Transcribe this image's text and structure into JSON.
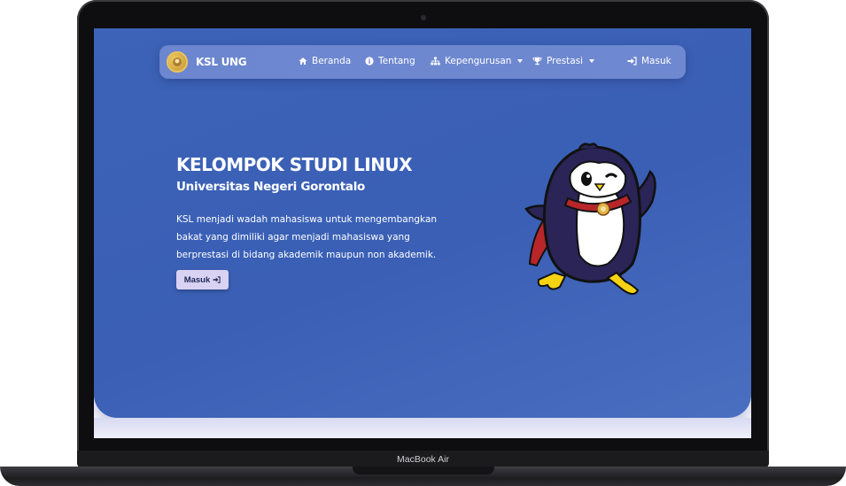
{
  "device": {
    "label": "MacBook Air"
  },
  "navbar": {
    "brand": "KSL UNG",
    "items": [
      {
        "label": "Beranda",
        "icon": "home-icon",
        "dropdown": false
      },
      {
        "label": "Tentang",
        "icon": "info-circle-icon",
        "dropdown": false
      },
      {
        "label": "Kepengurusan",
        "icon": "sitemap-icon",
        "dropdown": true
      },
      {
        "label": "Prestasi",
        "icon": "trophy-icon",
        "dropdown": true
      },
      {
        "label": "Masuk",
        "icon": "sign-in-icon",
        "dropdown": false
      }
    ]
  },
  "hero": {
    "title": "KELOMPOK STUDI LINUX",
    "subtitle": "Universitas Negeri Gorontalo",
    "description": "KSL menjadi wadah mahasiswa untuk mengembangkan bakat yang dimiliki agar menjadi mahasiswa yang berprestasi di bidang akademik maupun non akademik.",
    "cta_label": "Masuk"
  },
  "colors": {
    "hero_bg": "#3c63b8",
    "navbar_bg": "#6c86cf",
    "cta_bg": "#d9d2f3",
    "penguin_body": "#2a2457",
    "penguin_cape": "#b8262a",
    "penguin_feet": "#f5d312"
  }
}
